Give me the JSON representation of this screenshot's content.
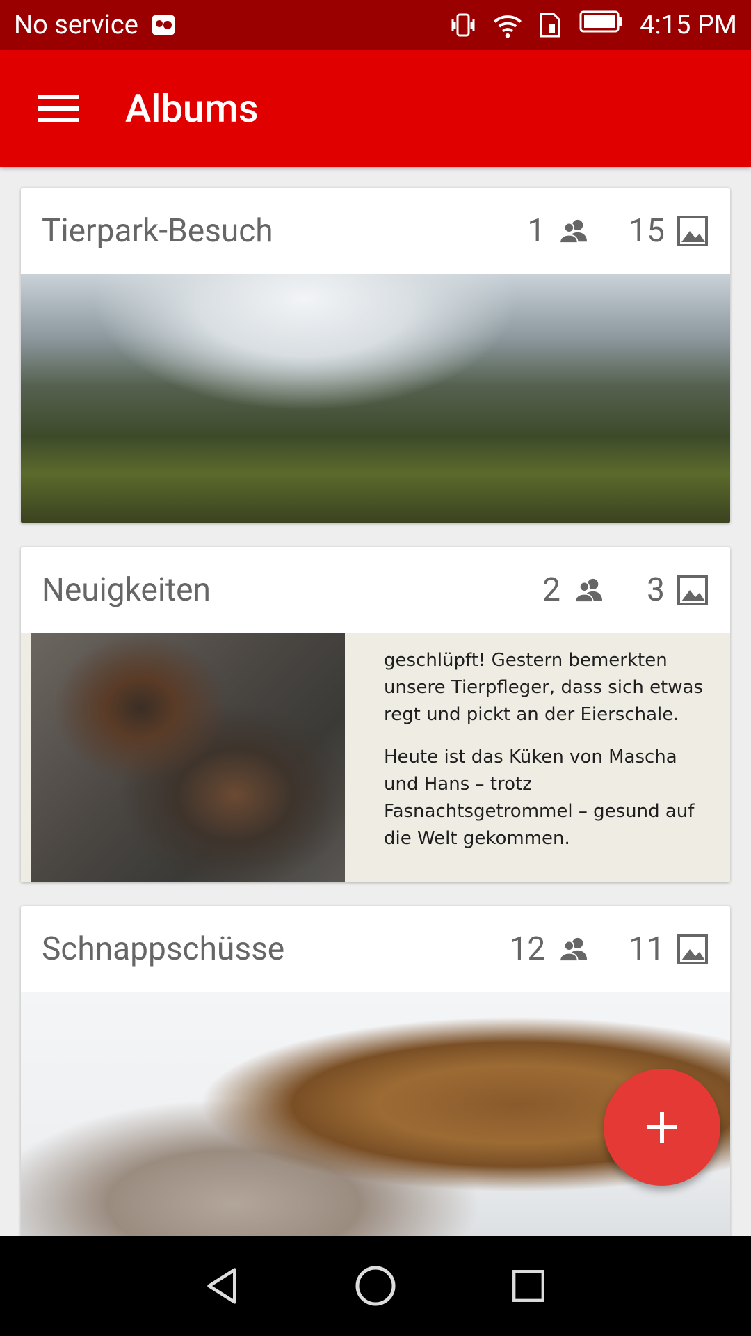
{
  "status_bar": {
    "carrier": "No service",
    "time": "4:15 PM",
    "icons": [
      "notification-app-icon",
      "vibrate-icon",
      "wifi-icon",
      "sim-icon",
      "battery-icon"
    ]
  },
  "app_bar": {
    "title": "Albums",
    "color": "#e00000"
  },
  "albums": [
    {
      "title": "Tierpark-Besuch",
      "members": "1",
      "photos": "15",
      "image": "forest-landscape"
    },
    {
      "title": "Neuigkeiten",
      "members": "2",
      "photos": "3",
      "image": "bird-nest-news",
      "image_text": [
        "geschlüpft! Gestern bemerkten unsere Tierpfleger, dass sich etwas regt und pickt an der Eierschale.",
        "Heute ist das Küken von Mascha und Hans – trotz Fasnachtsgetrommel – gesund auf die Welt gekommen."
      ]
    },
    {
      "title": "Schnappschüsse",
      "members": "12",
      "photos": "11",
      "image": "bear-in-snow"
    }
  ],
  "fab": {
    "icon": "add-icon",
    "color": "#e53935"
  },
  "nav_bar": {
    "icons": [
      "back-icon",
      "home-icon",
      "recents-icon"
    ]
  }
}
